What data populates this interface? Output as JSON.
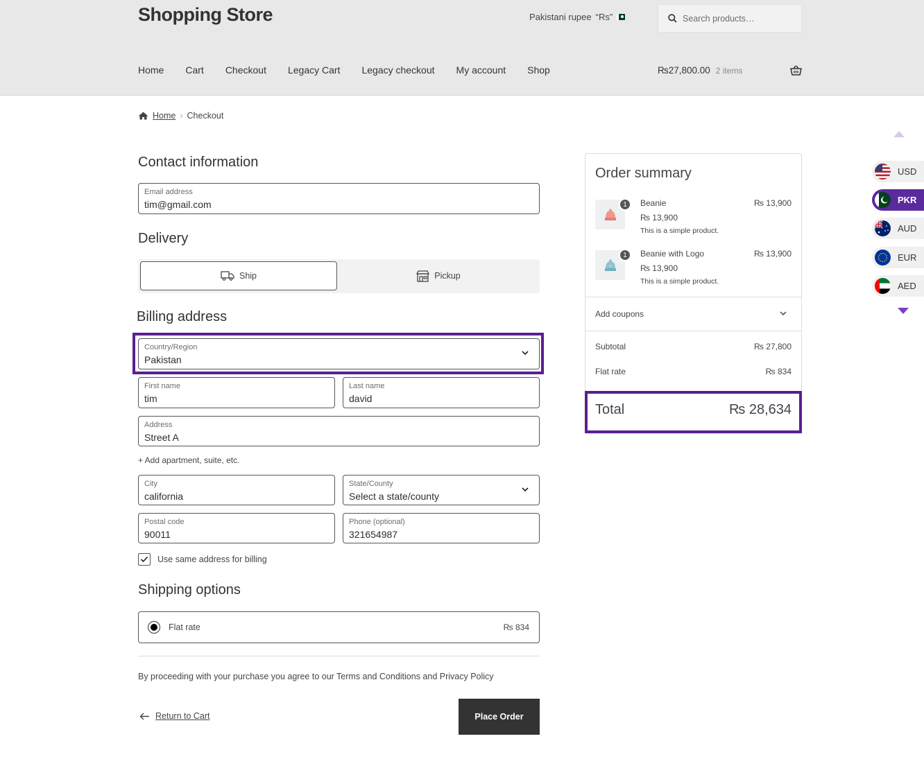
{
  "header": {
    "site_title": "Shopping Store",
    "currency_label": "Pakistani rupee",
    "currency_symbol": "“Rs”",
    "search_placeholder": "Search products…",
    "nav": [
      "Home",
      "Cart",
      "Checkout",
      "Legacy Cart",
      "Legacy checkout",
      "My account",
      "Shop"
    ],
    "cart_amount": "₨27,800.00",
    "cart_count": "2 items"
  },
  "breadcrumb": {
    "home": "Home",
    "current": "Checkout"
  },
  "contact": {
    "heading": "Contact information",
    "email_label": "Email address",
    "email_value": "tim@gmail.com"
  },
  "delivery": {
    "heading": "Delivery",
    "ship": "Ship",
    "pickup": "Pickup"
  },
  "billing": {
    "heading": "Billing address",
    "country_label": "Country/Region",
    "country_value": "Pakistan",
    "first_name_label": "First name",
    "first_name_value": "tim",
    "last_name_label": "Last name",
    "last_name_value": "david",
    "address_label": "Address",
    "address_value": "Street A",
    "add_apartment": "+ Add apartment, suite, etc.",
    "city_label": "City",
    "city_value": "california",
    "state_label": "State/County",
    "state_value": "Select a state/county",
    "postal_label": "Postal code",
    "postal_value": "90011",
    "phone_label": "Phone (optional)",
    "phone_value": "321654987",
    "same_address": "Use same address for billing"
  },
  "shipping": {
    "heading": "Shipping options",
    "option": "Flat rate",
    "price": "₨ 834"
  },
  "terms": "By proceeding with your purchase you agree to our Terms and Conditions and Privacy Policy",
  "actions": {
    "return": "Return to Cart",
    "place_order": "Place Order"
  },
  "summary": {
    "heading": "Order summary",
    "items": [
      {
        "qty": "1",
        "name": "Beanie",
        "unit_price": "₨ 13,900",
        "description": "This is a simple product.",
        "line_total": "₨ 13,900"
      },
      {
        "qty": "1",
        "name": "Beanie with Logo",
        "unit_price": "₨ 13,900",
        "description": "This is a simple product.",
        "line_total": "₨ 13,900"
      }
    ],
    "coupons": "Add coupons",
    "subtotal_label": "Subtotal",
    "subtotal_value": "₨ 27,800",
    "flat_rate_label": "Flat rate",
    "flat_rate_value": "₨ 834",
    "total_label": "Total",
    "total_value": "₨ 28,634"
  },
  "currency_switcher": [
    {
      "code": "USD",
      "active": false
    },
    {
      "code": "PKR",
      "active": true
    },
    {
      "code": "AUD",
      "active": false
    },
    {
      "code": "EUR",
      "active": false
    },
    {
      "code": "AED",
      "active": false
    }
  ],
  "colors": {
    "highlight": "#5a1f8f",
    "active_currency": "#5b2a9c",
    "button": "#333333"
  }
}
